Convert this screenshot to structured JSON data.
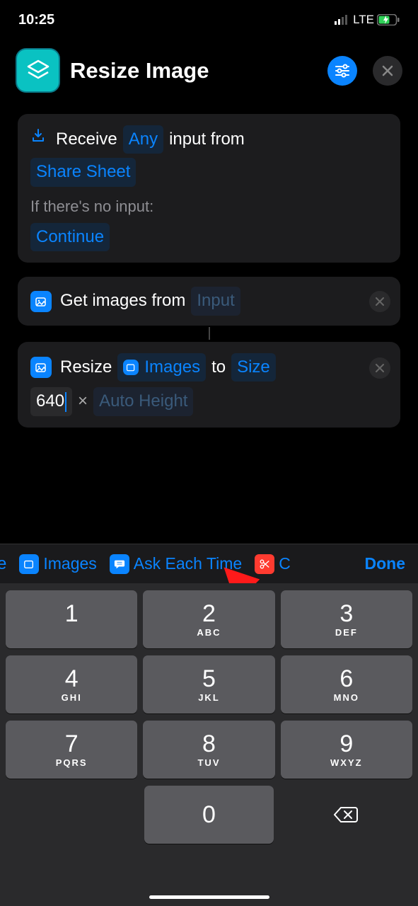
{
  "status": {
    "time": "10:25",
    "network": "LTE"
  },
  "header": {
    "title": "Resize Image"
  },
  "card1": {
    "receive_word": "Receive",
    "any": "Any",
    "input_from": "input from",
    "share_sheet": "Share Sheet",
    "no_input": "If there's no input:",
    "continue": "Continue"
  },
  "card2": {
    "get_images": "Get images from",
    "input": "Input"
  },
  "card3": {
    "resize": "Resize",
    "images": "Images",
    "to": "to",
    "size": "Size",
    "width": "640",
    "mult": "×",
    "auto_height": "Auto Height"
  },
  "suggestions": {
    "cut_left": "e",
    "images": "Images",
    "ask": "Ask Each Time",
    "done": "Done"
  },
  "keys": {
    "abc": "ABC",
    "def": "DEF",
    "ghi": "GHI",
    "jkl": "JKL",
    "mno": "MNO",
    "pqrs": "PQRS",
    "tuv": "TUV",
    "wxyz": "WXYZ",
    "n1": "1",
    "n2": "2",
    "n3": "3",
    "n4": "4",
    "n5": "5",
    "n6": "6",
    "n7": "7",
    "n8": "8",
    "n9": "9",
    "n0": "0"
  }
}
